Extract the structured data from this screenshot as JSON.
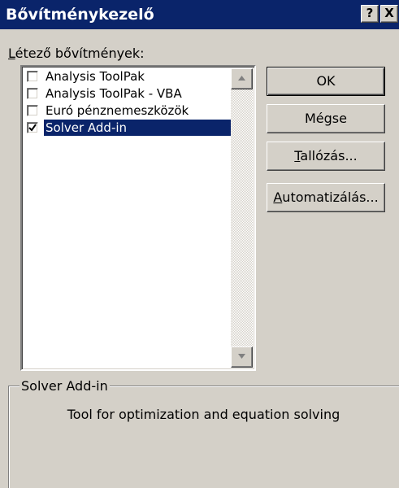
{
  "window": {
    "title": "Bővítménykezelő",
    "help_button": "?",
    "close_button": "X"
  },
  "addins_label": {
    "accel": "L",
    "rest": "étező bővítmények:"
  },
  "addins": [
    {
      "label": "Analysis ToolPak",
      "checked": false,
      "selected": false
    },
    {
      "label": "Analysis ToolPak - VBA",
      "checked": false,
      "selected": false
    },
    {
      "label": "Euró pénznemeszközök",
      "checked": false,
      "selected": false
    },
    {
      "label": "Solver Add-in",
      "checked": true,
      "selected": true
    }
  ],
  "buttons": {
    "ok": "OK",
    "cancel": "Mégse",
    "browse": {
      "accel": "T",
      "rest": "allózás..."
    },
    "automation": {
      "accel": "A",
      "rest": "utomatizálás..."
    }
  },
  "details": {
    "title": "Solver Add-in",
    "description": "Tool for optimization and equation solving"
  }
}
